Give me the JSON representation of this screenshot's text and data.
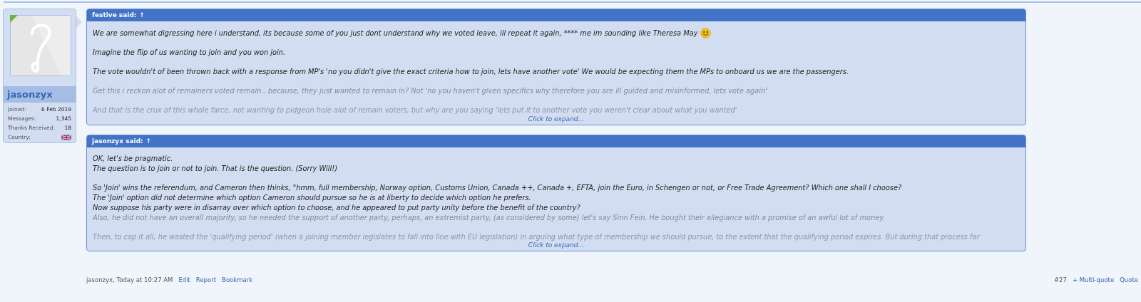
{
  "user": {
    "name": "jasonzyx",
    "online": true,
    "stats": [
      {
        "label": "Joined:",
        "value": "6 Feb 2019",
        "kind": "text"
      },
      {
        "label": "Messages:",
        "value": "1,345",
        "kind": "text"
      },
      {
        "label": "Thanks Received:",
        "value": "18",
        "kind": "text"
      },
      {
        "label": "Country:",
        "kind": "flag"
      }
    ]
  },
  "quotes": [
    {
      "header": "festive said:",
      "arrow": "↑",
      "expand": "Click to expand...",
      "paragraphs": [
        {
          "lines": [
            {
              "text": "We are somewhat digressing here i understand, its because some of you just dont understand why we voted leave, ill repeat it again, **** me im sounding like Theresa May",
              "kind": "plain",
              "smiley": true
            }
          ]
        },
        {
          "lines": [
            {
              "text": "Imagine the flip of us wanting to join and you won join.",
              "kind": "plain"
            }
          ]
        },
        {
          "lines": [
            {
              "text": "The vote wouldn't of been thrown back with a response from MP's 'no you didn't give the exact criteria how to join, lets have another vote' We would be expecting them the MPs to onboard us we are the passengers.",
              "kind": "plain"
            }
          ]
        },
        {
          "lines": [
            {
              "text": "Get this i reckon alot of remainers voted remain.. because, they just wanted to remain in? Not 'no you haven't given specifics why therefore you are ill guided and misinformed, lets vote again'",
              "kind": "dim"
            }
          ]
        },
        {
          "lines": [
            {
              "text": "And that is the crux of this whole farce, not wanting to pidgeon hole alot of remain voters, but why are you saying 'lets put it to another vote you weren't clear about what you wanted'",
              "kind": "faint"
            }
          ]
        }
      ]
    },
    {
      "header": "jasonzyx said:",
      "arrow": "↑",
      "expand": "Click to expand...",
      "paragraphs": [
        {
          "lines": [
            {
              "text": "OK, let's be pragmatic.",
              "kind": "plain"
            },
            {
              "text": "The question is to join or not to join. That is the question. (Sorry Will!)",
              "kind": "plain"
            }
          ]
        },
        {
          "lines": [
            {
              "text": "So 'Join' wins the referendum, and Cameron then thinks, \"hmm, full membership, Norway option, Customs Union, Canada ++, Canada +, EFTA, join the Euro, in Schengen or not, or Free Trade Agreement? Which one shall I choose?",
              "kind": "plain"
            },
            {
              "text": "The 'Join' option did not determine which option Cameron should pursue so he is at liberty to decide which option he prefers.",
              "kind": "plain"
            },
            {
              "text": "Now suppose his party were in disarray over which option to choose, and he appeared to put party unity before the benefit of the country?",
              "kind": "plain"
            },
            {
              "text": "Also, he did not have an overall majority, so he needed the support of another party, perhaps, an extremist party, (as considered by some) let's say Sinn Fein. He bought their allegiance with a promise of an awful lot of money.",
              "kind": "dim"
            }
          ]
        },
        {
          "lines": [
            {
              "text": "Then, to cap it all, he wasted the 'qualifying period' (when a joining member legislates to fall into line with EU legislation) in arguing what type of membership we should pursue, to the extent that the qualifying period expires. But during that process far",
              "kind": "faint"
            }
          ]
        }
      ]
    }
  ],
  "footer": {
    "meta": "jasonzyx, Today at 10:27 AM",
    "links": [
      "Edit",
      "Report",
      "Bookmark"
    ],
    "number": "#27",
    "actions": [
      "+ Multi-quote",
      "Quote"
    ]
  }
}
